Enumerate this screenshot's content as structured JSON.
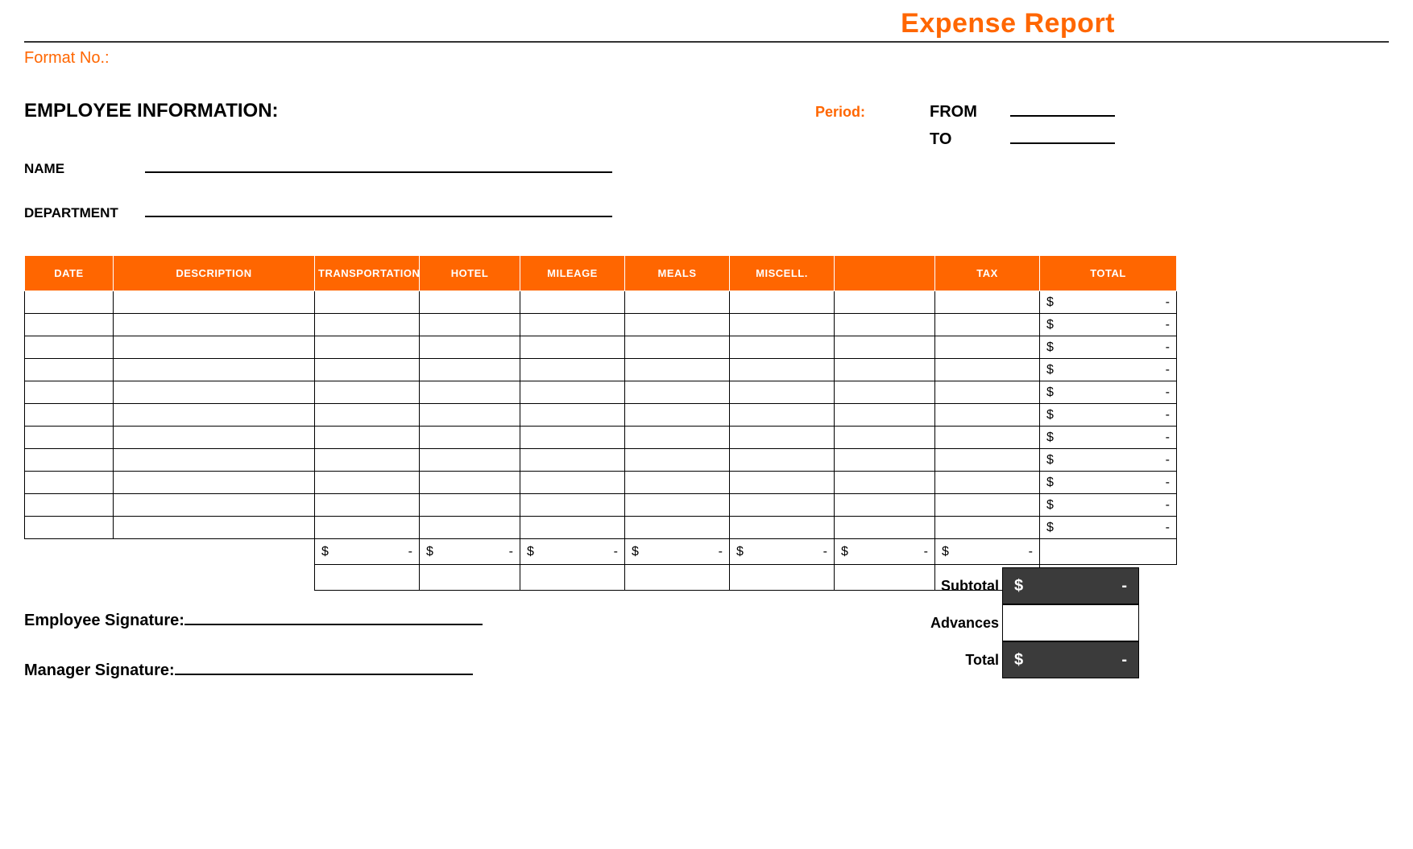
{
  "doc": {
    "title": "Expense Report",
    "format_no_label": "Format No.:"
  },
  "emp": {
    "section_label": "EMPLOYEE INFORMATION:",
    "name_label": "NAME",
    "dept_label": "DEPARTMENT"
  },
  "period": {
    "label": "Period:",
    "from_label": "FROM",
    "to_label": "TO"
  },
  "table": {
    "headers": {
      "date": "DATE",
      "description": "DESCRIPTION",
      "transportation": "TRANSPORTATION",
      "hotel": "HOTEL",
      "mileage": "MILEAGE",
      "meals": "MEALS",
      "miscell": "MISCELL.",
      "blank": "",
      "tax": "TAX",
      "total": "TOTAL"
    },
    "rows": [
      {
        "total_sym": "$",
        "total_val": "-"
      },
      {
        "total_sym": "$",
        "total_val": "-"
      },
      {
        "total_sym": "$",
        "total_val": "-"
      },
      {
        "total_sym": "$",
        "total_val": "-"
      },
      {
        "total_sym": "$",
        "total_val": "-"
      },
      {
        "total_sym": "$",
        "total_val": "-"
      },
      {
        "total_sym": "$",
        "total_val": "-"
      },
      {
        "total_sym": "$",
        "total_val": "-"
      },
      {
        "total_sym": "$",
        "total_val": "-"
      },
      {
        "total_sym": "$",
        "total_val": "-"
      },
      {
        "total_sym": "$",
        "total_val": "-"
      }
    ],
    "col_totals": [
      {
        "sym": "$",
        "val": "-"
      },
      {
        "sym": "$",
        "val": "-"
      },
      {
        "sym": "$",
        "val": "-"
      },
      {
        "sym": "$",
        "val": "-"
      },
      {
        "sym": "$",
        "val": "-"
      },
      {
        "sym": "$",
        "val": "-"
      },
      {
        "sym": "$",
        "val": "-"
      }
    ]
  },
  "summary": {
    "subtotal_label": "Subtotal",
    "subtotal_sym": "$",
    "subtotal_val": "-",
    "advances_label": "Advances",
    "total_label": "Total",
    "total_sym": "$",
    "total_val": "-"
  },
  "signatures": {
    "employee_label": "Employee Signature:",
    "manager_label": "Manager Signature:"
  }
}
